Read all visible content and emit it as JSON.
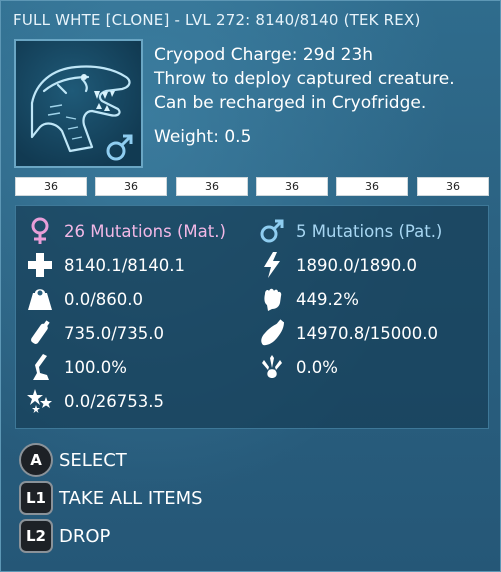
{
  "header": {
    "title": "FULL WHTE [CLONE] - LVL 272: 8140/8140 (TEK REX)"
  },
  "portrait": {
    "creature_icon": "tek-rex-icon",
    "gender_icon": "male-icon"
  },
  "info": {
    "charge": "Cryopod Charge: 29d 23h",
    "desc_line1": "Throw to deploy captured creature.",
    "desc_line2": "Can be recharged in Cryofridge.",
    "weight": "Weight: 0.5"
  },
  "quality_bars": [
    "36",
    "36",
    "36",
    "36",
    "36",
    "36"
  ],
  "stats": {
    "mutations_mat": "26 Mutations (Mat.)",
    "mutations_pat": "5 Mutations (Pat.)",
    "health": "8140.1/8140.1",
    "stamina": "1890.0/1890.0",
    "weight": "0.0/860.0",
    "melee": "449.2%",
    "oxygen": "735.0/735.0",
    "food": "14970.8/15000.0",
    "speed": "100.0%",
    "torpor": "0.0%",
    "experience": "0.0/26753.5"
  },
  "colors": {
    "female": "#e89ed8",
    "male": "#8fcdf0",
    "accent": "#6aa6c4"
  },
  "controls": [
    {
      "button": "A",
      "label": "SELECT"
    },
    {
      "button": "L1",
      "label": "TAKE ALL ITEMS"
    },
    {
      "button": "L2",
      "label": "DROP"
    }
  ]
}
